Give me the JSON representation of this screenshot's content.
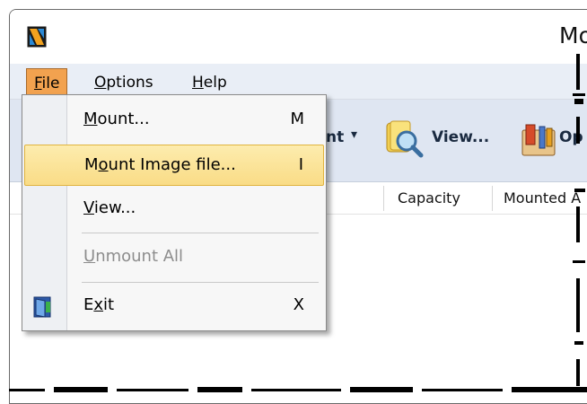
{
  "window": {
    "title": "Mo"
  },
  "menubar": {
    "items": [
      {
        "label": "File",
        "accel": "F",
        "rest": "ile"
      },
      {
        "label": "Options",
        "accel": "O",
        "rest": "ptions"
      },
      {
        "label": "Help",
        "accel": "H",
        "rest": "elp"
      }
    ]
  },
  "toolbar": {
    "mount_partial": "nt",
    "dropdown_arrow": "▾",
    "view_label": "View...",
    "options_partial": "Op"
  },
  "columns": {
    "capacity": "Capacity",
    "mounted": "Mounted A"
  },
  "file_menu": {
    "mount": {
      "accel": "M",
      "rest": "ount...",
      "shortcut": "M"
    },
    "mount_image": {
      "before": "M",
      "accel": "o",
      "rest": "unt Image file...",
      "shortcut": "I"
    },
    "view": {
      "accel": "V",
      "rest": "iew..."
    },
    "unmount_all": {
      "accel": "U",
      "rest": "nmount All"
    },
    "exit": {
      "before": "E",
      "accel": "x",
      "rest": "it",
      "shortcut": "X"
    }
  },
  "colors": {
    "menu_active": "#f2a24f",
    "highlight": "#fbe39a",
    "toolbar_bg": "#dfe6f2",
    "menubar_bg": "#e9eef6"
  }
}
